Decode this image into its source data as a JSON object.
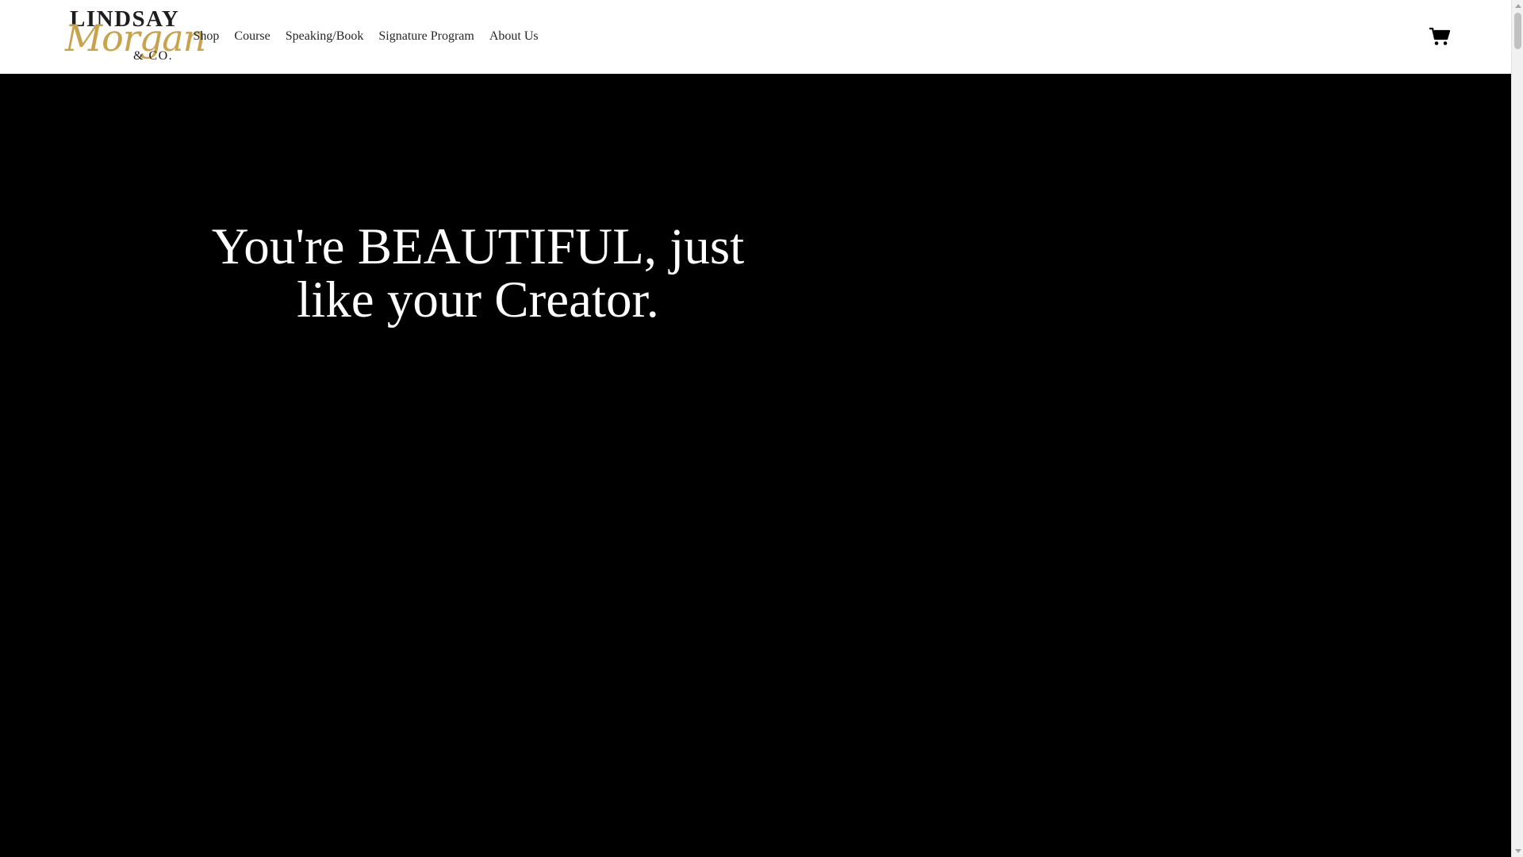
{
  "header": {
    "logo": {
      "line1": "LINDSAY",
      "script": "Morgan",
      "line3": "& CO."
    },
    "nav": [
      {
        "label": "Shop"
      },
      {
        "label": "Course"
      },
      {
        "label": "Speaking/Book"
      },
      {
        "label": "Signature Program"
      },
      {
        "label": "About Us"
      }
    ],
    "cart_icon": "cart-icon"
  },
  "hero": {
    "title": "You're BEAUTIFUL, just like your Creator."
  },
  "colors": {
    "logo_gold": "#c9a24c",
    "hero_background": "#000000",
    "hero_text": "#ffffff",
    "header_background": "#ffffff"
  }
}
